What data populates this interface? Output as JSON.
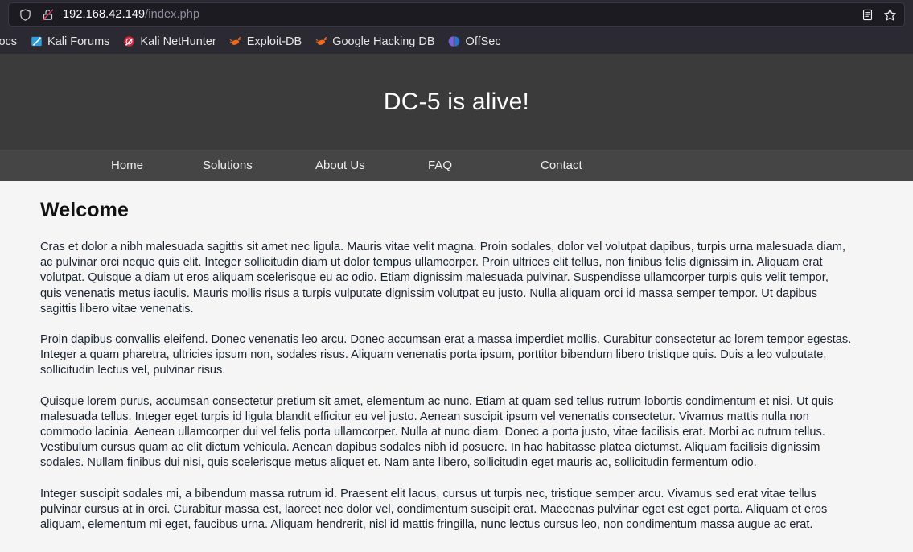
{
  "browser": {
    "urlbar": {
      "url_host": "192.168.42.149",
      "url_path": "/index.php",
      "shield_icon": "shield-icon",
      "connection_icon": "lock-broken-icon",
      "reader_icon": "reader-view-icon",
      "bookmark_icon": "star-icon"
    },
    "bookmarks": [
      {
        "label": "Docs",
        "icon": "kali-docs-icon",
        "clipped": true
      },
      {
        "label": "Kali Forums",
        "icon": "kali-forums-icon"
      },
      {
        "label": "Kali NetHunter",
        "icon": "kali-nethunter-icon"
      },
      {
        "label": "Exploit-DB",
        "icon": "exploit-db-icon"
      },
      {
        "label": "Google Hacking DB",
        "icon": "google-hacking-db-icon"
      },
      {
        "label": "OffSec",
        "icon": "offsec-icon"
      }
    ]
  },
  "site": {
    "title": "DC-5 is alive!",
    "nav": [
      {
        "label": "Home"
      },
      {
        "label": "Solutions"
      },
      {
        "label": "About Us"
      },
      {
        "label": "FAQ"
      },
      {
        "label": "Contact"
      }
    ],
    "heading": "Welcome",
    "paragraphs": [
      "Cras et dolor a nibh malesuada sagittis sit amet nec ligula. Mauris vitae velit magna. Proin sodales, dolor vel volutpat dapibus, turpis urna malesuada diam, ac pulvinar orci neque quis elit. Integer sollicitudin diam ut dolor tempus ullamcorper. Proin ultrices elit tellus, non finibus felis dignissim in. Aliquam erat volutpat. Quisque a diam ut eros aliquam scelerisque eu ac odio. Etiam dignissim malesuada pulvinar. Suspendisse ullamcorper turpis quis velit tempor, quis venenatis metus iaculis. Mauris mollis risus a turpis vulputate dignissim volutpat eu justo. Nulla aliquam orci id massa semper tempor. Ut dapibus sagittis libero vitae venenatis.",
      "Proin dapibus convallis eleifend. Donec venenatis leo arcu. Donec accumsan erat a massa imperdiet mollis. Curabitur consectetur ac lorem tempor egestas. Integer a quam pharetra, ultricies ipsum non, sodales risus. Aliquam venenatis porta ipsum, porttitor bibendum libero tristique quis. Duis a leo vulputate, sollicitudin lectus vel, pulvinar risus.",
      "Quisque lorem purus, accumsan consectetur pretium sit amet, elementum ac nunc. Etiam at quam sed tellus rutrum lobortis condimentum et nisi. Ut quis malesuada tellus. Integer eget turpis id ligula blandit efficitur eu vel justo. Aenean suscipit ipsum vel venenatis consectetur. Vivamus mattis nulla non commodo lacinia. Aenean ullamcorper dui vel felis porta ullamcorper. Nulla at nunc diam. Donec a porta justo, vitae facilisis erat. Morbi ac rutrum tellus. Vestibulum cursus quam ac elit dictum vehicula. Aenean dapibus sodales nibh id posuere. In hac habitasse platea dictumst. Aliquam facilisis dignissim sodales. Nullam finibus dui nisi, quis scelerisque metus aliquet et. Nam ante libero, sollicitudin eget mauris ac, sollicitudin fermentum odio.",
      "Integer suscipit sodales mi, a bibendum massa rutrum id. Praesent elit lacus, cursus ut turpis nec, tristique semper arcu. Vivamus sed erat vitae tellus pulvinar cursus at in orci. Curabitur massa est, laoreet nec dolor vel, condimentum suscipit erat. Maecenas pulvinar eget est eget porta. Aliquam et eros aliquam, elementum mi eget, faucibus urna. Aliquam hendrerit, nisl id mattis fringilla, nunc lectus cursus leo, non condimentum massa augue ac erat."
    ]
  },
  "colors": {
    "chrome_bg": "#2b2a33",
    "urlbar_bg": "#1c1b22",
    "header_bg": "#3b3b3b",
    "nav_bg": "#454545",
    "page_bg": "#f5f5f5",
    "text": "#1a2330",
    "accent_orange": "#ee6a1e",
    "accent_blue": "#3b8fd8",
    "accent_purple": "#7b61d9"
  }
}
